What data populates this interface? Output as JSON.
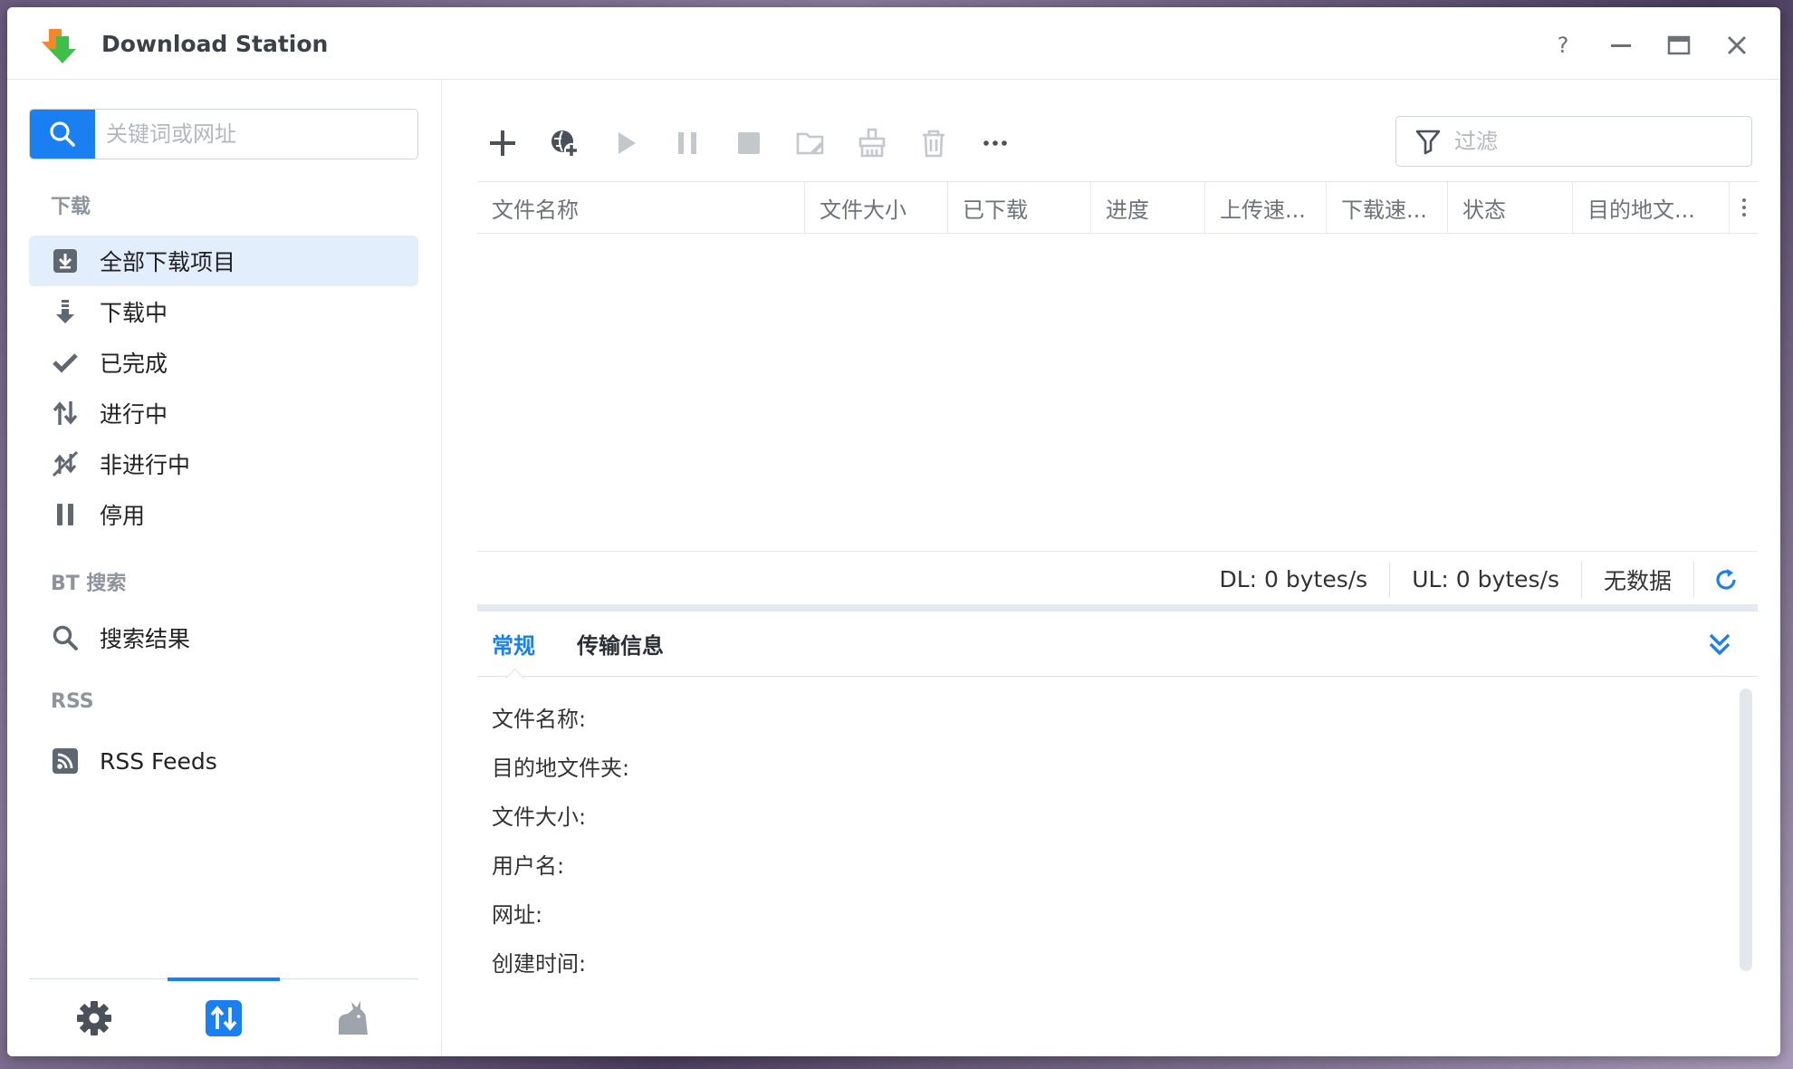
{
  "window": {
    "title": "Download Station"
  },
  "titlebar_buttons": [
    "help-icon",
    "minimize-icon",
    "maximize-icon",
    "close-icon"
  ],
  "colors": {
    "accent": "#1a7ff0",
    "active_nav_bg": "#e3eefc",
    "text": "#222222",
    "muted": "#8d949c"
  },
  "sidebar": {
    "search_placeholder": "关键词或网址",
    "sections": {
      "downloads": "下载",
      "bt_search": "BT 搜索",
      "rss": "RSS"
    },
    "items": [
      {
        "label": "全部下载项目",
        "icon": "download-box-icon",
        "active": true
      },
      {
        "label": "下载中",
        "icon": "downloading-icon"
      },
      {
        "label": "已完成",
        "icon": "check-icon"
      },
      {
        "label": "进行中",
        "icon": "up-down-arrows-icon"
      },
      {
        "label": "非进行中",
        "icon": "inactive-arrows-icon"
      },
      {
        "label": "停用",
        "icon": "pause-icon"
      }
    ],
    "bt_items": [
      {
        "label": "搜索结果",
        "icon": "search-icon"
      }
    ],
    "rss_items": [
      {
        "label": "RSS Feeds",
        "icon": "rss-icon"
      }
    ],
    "footer_tabs": [
      "settings-icon",
      "transfers-icon",
      "emule-icon"
    ]
  },
  "toolbar": {
    "buttons": [
      "add-icon",
      "add-url-icon",
      "play-icon",
      "pause-icon",
      "stop-icon",
      "edit-folder-icon",
      "clear-icon",
      "delete-icon",
      "more-icon"
    ],
    "filter_placeholder": "过滤"
  },
  "grid": {
    "columns": [
      "文件名称",
      "文件大小",
      "已下载",
      "进度",
      "上传速...",
      "下载速...",
      "状态",
      "目的地文..."
    ]
  },
  "status": {
    "dl": "DL: 0 bytes/s",
    "ul": "UL: 0 bytes/s",
    "no_data": "无数据"
  },
  "details": {
    "tabs": [
      "常规",
      "传输信息"
    ],
    "fields": [
      "文件名称:",
      "目的地文件夹:",
      "文件大小:",
      "用户名:",
      "网址:",
      "创建时间:"
    ]
  }
}
